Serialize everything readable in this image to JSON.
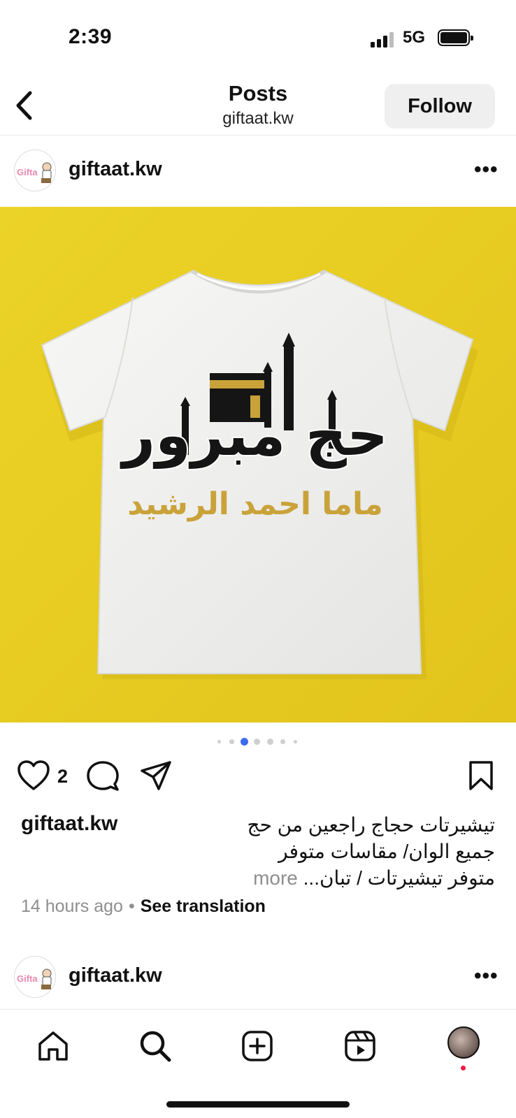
{
  "status_bar": {
    "time": "2:39",
    "network": "5G"
  },
  "header": {
    "title": "Posts",
    "subtitle": "giftaat.kw",
    "follow_label": "Follow"
  },
  "post": {
    "username": "giftaat.kw",
    "avatar_text": "Gifta",
    "shirt_title_text": "حج مبرور",
    "shirt_name_text": "ماما احمد الرشيد",
    "like_count": "2",
    "caption_user": "giftaat.kw",
    "caption_line1": "تيشيرتات حجاج راجعين من حج",
    "caption_line2": "جميع الوان/ مقاسات متوفر",
    "caption_line3": "متوفر تيشيرتات / تبان...",
    "caption_more": "more",
    "time_ago": "14 hours ago",
    "separator": "•",
    "see_translation": "See translation",
    "carousel": {
      "count": 6,
      "active_index": 2
    }
  },
  "next_post": {
    "username": "giftaat.kw",
    "avatar_text": "Gifta"
  },
  "tab_bar": {
    "items": [
      "home-icon",
      "search-icon",
      "create-icon",
      "reels-icon",
      "profile-avatar"
    ]
  },
  "colors": {
    "image_background": "#e6cd22",
    "carousel_active": "#3d6cf0",
    "kaaba_gold": "#c9a23a",
    "notification": "#ed1c40"
  }
}
